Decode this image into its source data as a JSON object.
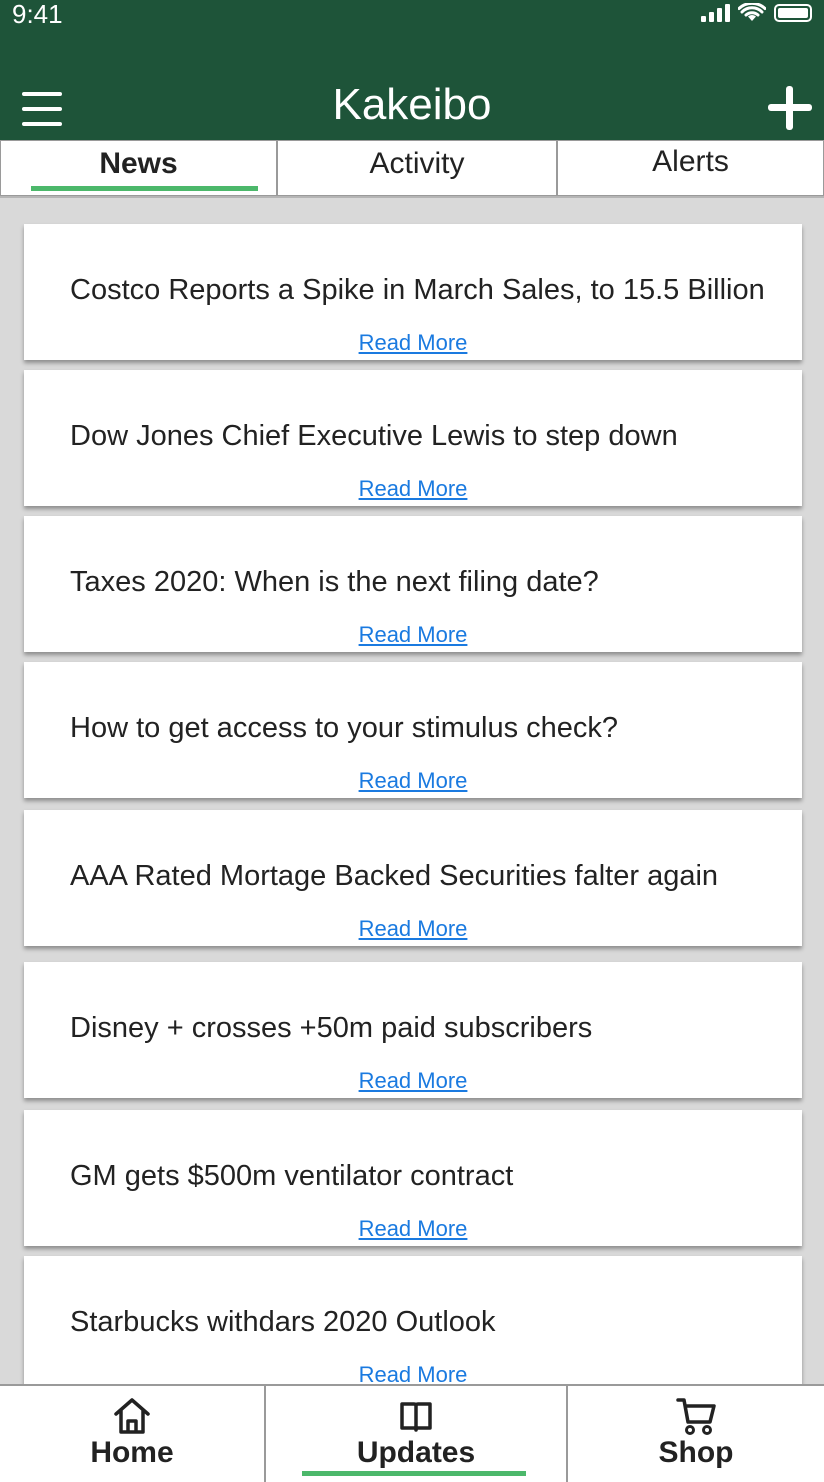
{
  "status_bar": {
    "time": "9:41"
  },
  "header": {
    "title": "Kakeibo"
  },
  "tabs": [
    {
      "label": "News",
      "active": true
    },
    {
      "label": "Activity",
      "active": false
    },
    {
      "label": "Alerts",
      "active": false
    }
  ],
  "news": [
    {
      "title": "Costco Reports a Spike in March Sales, to 15.5 Billion",
      "link": "Read More"
    },
    {
      "title": "Dow Jones Chief Executive Lewis to step down",
      "link": "Read More"
    },
    {
      "title": "Taxes 2020: When is the next filing date?",
      "link": "Read More"
    },
    {
      "title": "How to get access to your stimulus check?",
      "link": "Read More"
    },
    {
      "title": "AAA Rated Mortage Backed Securities falter again",
      "link": "Read More"
    },
    {
      "title": "Disney + crosses +50m paid subscribers",
      "link": "Read More"
    },
    {
      "title": "GM gets $500m ventilator contract",
      "link": "Read More"
    },
    {
      "title": "Starbucks withdars 2020 Outlook",
      "link": "Read More"
    }
  ],
  "bottom_nav": [
    {
      "label": "Home",
      "icon": "home-icon",
      "active": false
    },
    {
      "label": "Updates",
      "icon": "book-icon",
      "active": true
    },
    {
      "label": "Shop",
      "icon": "cart-icon",
      "active": false
    }
  ],
  "colors": {
    "header": "#1e5439",
    "accent": "#4cb86b",
    "link": "#1a7ae0",
    "background": "#d9d9d9"
  }
}
